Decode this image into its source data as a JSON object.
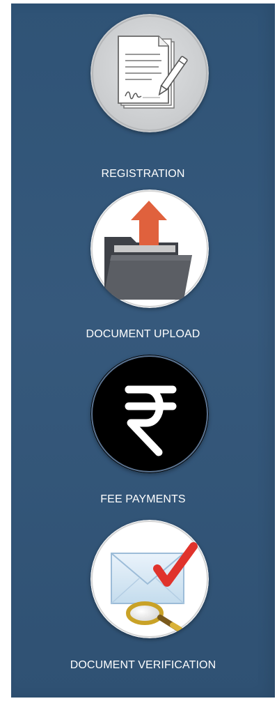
{
  "steps": [
    {
      "label": "REGISTRATION",
      "icon": "document-sign-icon"
    },
    {
      "label": "DOCUMENT UPLOAD",
      "icon": "folder-upload-icon"
    },
    {
      "label": "FEE PAYMENTS",
      "icon": "rupee-icon"
    },
    {
      "label": "DOCUMENT VERIFICATION",
      "icon": "envelope-check-magnifier-icon"
    }
  ],
  "colors": {
    "panel": "#335579",
    "label": "#ffffff",
    "upload_arrow": "#e0613d",
    "check": "#e0332c",
    "rupee_bg": "#000000"
  }
}
